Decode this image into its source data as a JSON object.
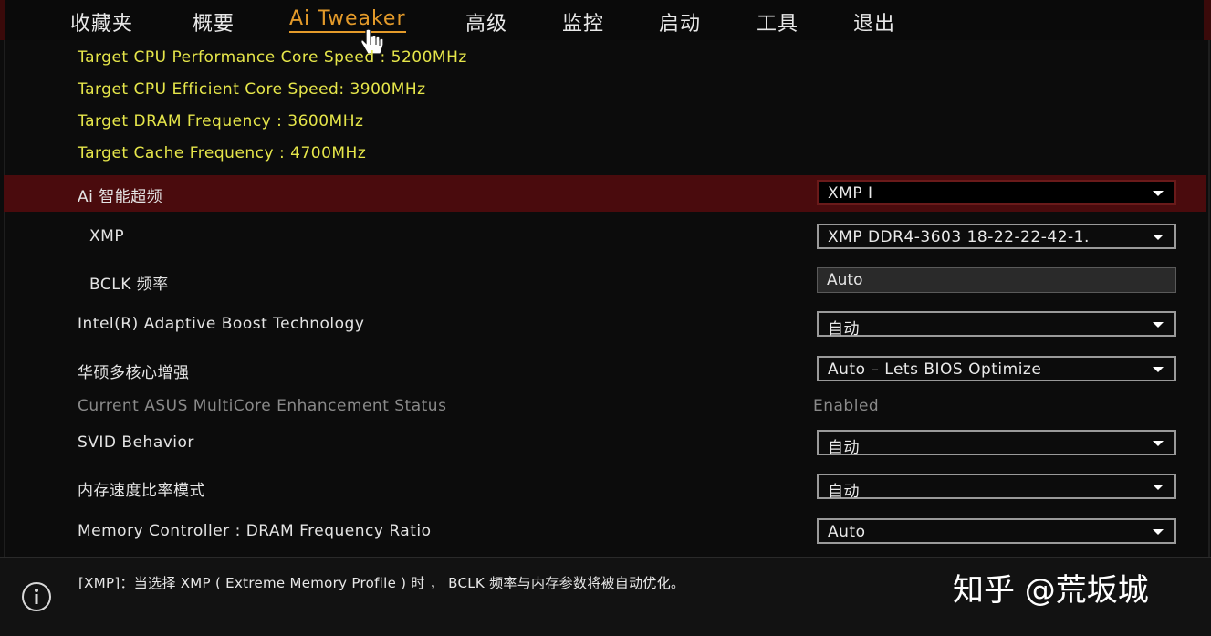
{
  "nav": {
    "tabs": [
      {
        "label": "收藏夹"
      },
      {
        "label": "概要"
      },
      {
        "label": "Ai Tweaker",
        "active": true
      },
      {
        "label": "高级"
      },
      {
        "label": "监控"
      },
      {
        "label": "启动"
      },
      {
        "label": "工具"
      },
      {
        "label": "退出"
      }
    ]
  },
  "info_lines": [
    "Target CPU Performance Core Speed : 5200MHz",
    "Target CPU Efficient Core Speed: 3900MHz",
    "Target DRAM Frequency : 3600MHz",
    "Target Cache Frequency : 4700MHz"
  ],
  "settings": [
    {
      "label": "Ai 智能超频",
      "value": "XMP I",
      "kind": "dropdown",
      "selected": true
    },
    {
      "label": "XMP",
      "value": "XMP DDR4-3603 18-22-22-42-1.",
      "kind": "dropdown"
    },
    {
      "label": "BCLK 频率",
      "value": "Auto",
      "kind": "field"
    },
    {
      "label": "Intel(R) Adaptive Boost Technology",
      "value": "自动",
      "kind": "dropdown"
    },
    {
      "label": "华硕多核心增强",
      "value": "Auto – Lets BIOS Optimize",
      "kind": "dropdown"
    },
    {
      "label": "Current ASUS MultiCore Enhancement Status",
      "value": "Enabled",
      "kind": "static"
    },
    {
      "label": "SVID Behavior",
      "value": "自动",
      "kind": "dropdown"
    },
    {
      "label": "内存速度比率模式",
      "value": "自动",
      "kind": "dropdown"
    },
    {
      "label": "Memory Controller : DRAM Frequency Ratio",
      "value": "Auto",
      "kind": "dropdown"
    }
  ],
  "help": {
    "text": "[XMP]：当选择 XMP ( Extreme Memory Profile ) 时 ， BCLK 频率与内存参数将被自动优化。",
    "icon": "info-icon"
  },
  "watermark": "知乎 @荒坂城",
  "colors": {
    "accent": "#e39a2a",
    "info_text": "#e6e64a",
    "selected_row": "#4a0b0d"
  }
}
